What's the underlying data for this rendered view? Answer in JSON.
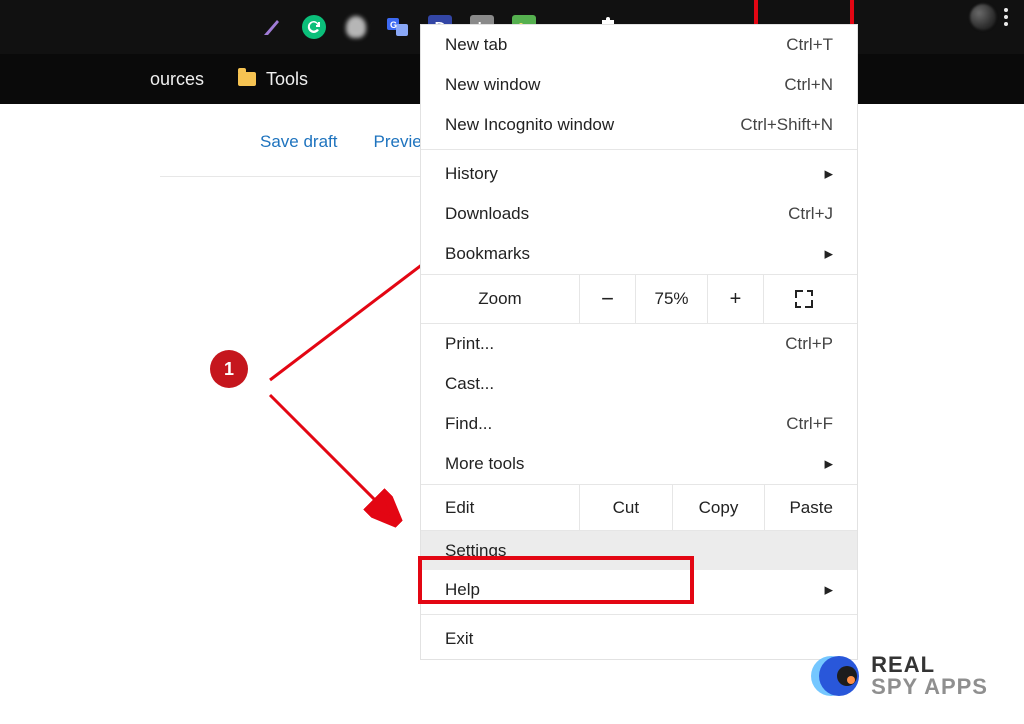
{
  "toolbar": {
    "icons": [
      {
        "name": "feather-icon",
        "bg": "#111",
        "fg": "#a07bd6"
      },
      {
        "name": "grammarly-icon",
        "bg": "#0bbf7a",
        "fg": "#fff"
      },
      {
        "name": "blob-icon",
        "bg": "#b6b6b6",
        "fg": "#333"
      },
      {
        "name": "translate-icon",
        "bg": "#3d6af2",
        "fg": "#fff"
      },
      {
        "name": "d-icon",
        "bg": "#3346a5",
        "fg": "#fff"
      },
      {
        "name": "h-icon",
        "bg": "#8a8a8a",
        "fg": "#fff"
      },
      {
        "name": "picture-icon",
        "bg": "#55b04f",
        "fg": "#fff"
      },
      {
        "name": "link-icon",
        "bg": "#111",
        "fg": "#4fa4e8"
      },
      {
        "name": "puzzle-icon",
        "bg": "#111",
        "fg": "#fff"
      }
    ]
  },
  "bookmarkBar": {
    "items": [
      {
        "label": "ources"
      },
      {
        "label": "Tools"
      }
    ]
  },
  "pageLinks": {
    "save_draft": "Save draft",
    "preview": "Preview"
  },
  "annotation": {
    "badge": "1"
  },
  "menu": {
    "new_tab": {
      "label": "New tab",
      "shortcut": "Ctrl+T"
    },
    "new_window": {
      "label": "New window",
      "shortcut": "Ctrl+N"
    },
    "incognito": {
      "label": "New Incognito window",
      "shortcut": "Ctrl+Shift+N"
    },
    "history": {
      "label": "History"
    },
    "downloads": {
      "label": "Downloads",
      "shortcut": "Ctrl+J"
    },
    "bookmarks": {
      "label": "Bookmarks"
    },
    "zoom": {
      "label": "Zoom",
      "value": "75%"
    },
    "print": {
      "label": "Print...",
      "shortcut": "Ctrl+P"
    },
    "cast": {
      "label": "Cast..."
    },
    "find": {
      "label": "Find...",
      "shortcut": "Ctrl+F"
    },
    "more_tools": {
      "label": "More tools"
    },
    "edit": {
      "label": "Edit",
      "cut": "Cut",
      "copy": "Copy",
      "paste": "Paste"
    },
    "settings": {
      "label": "Settings"
    },
    "help": {
      "label": "Help"
    },
    "exit": {
      "label": "Exit"
    }
  },
  "watermark": {
    "line1": "REAL",
    "line2": "SPY APPS"
  }
}
